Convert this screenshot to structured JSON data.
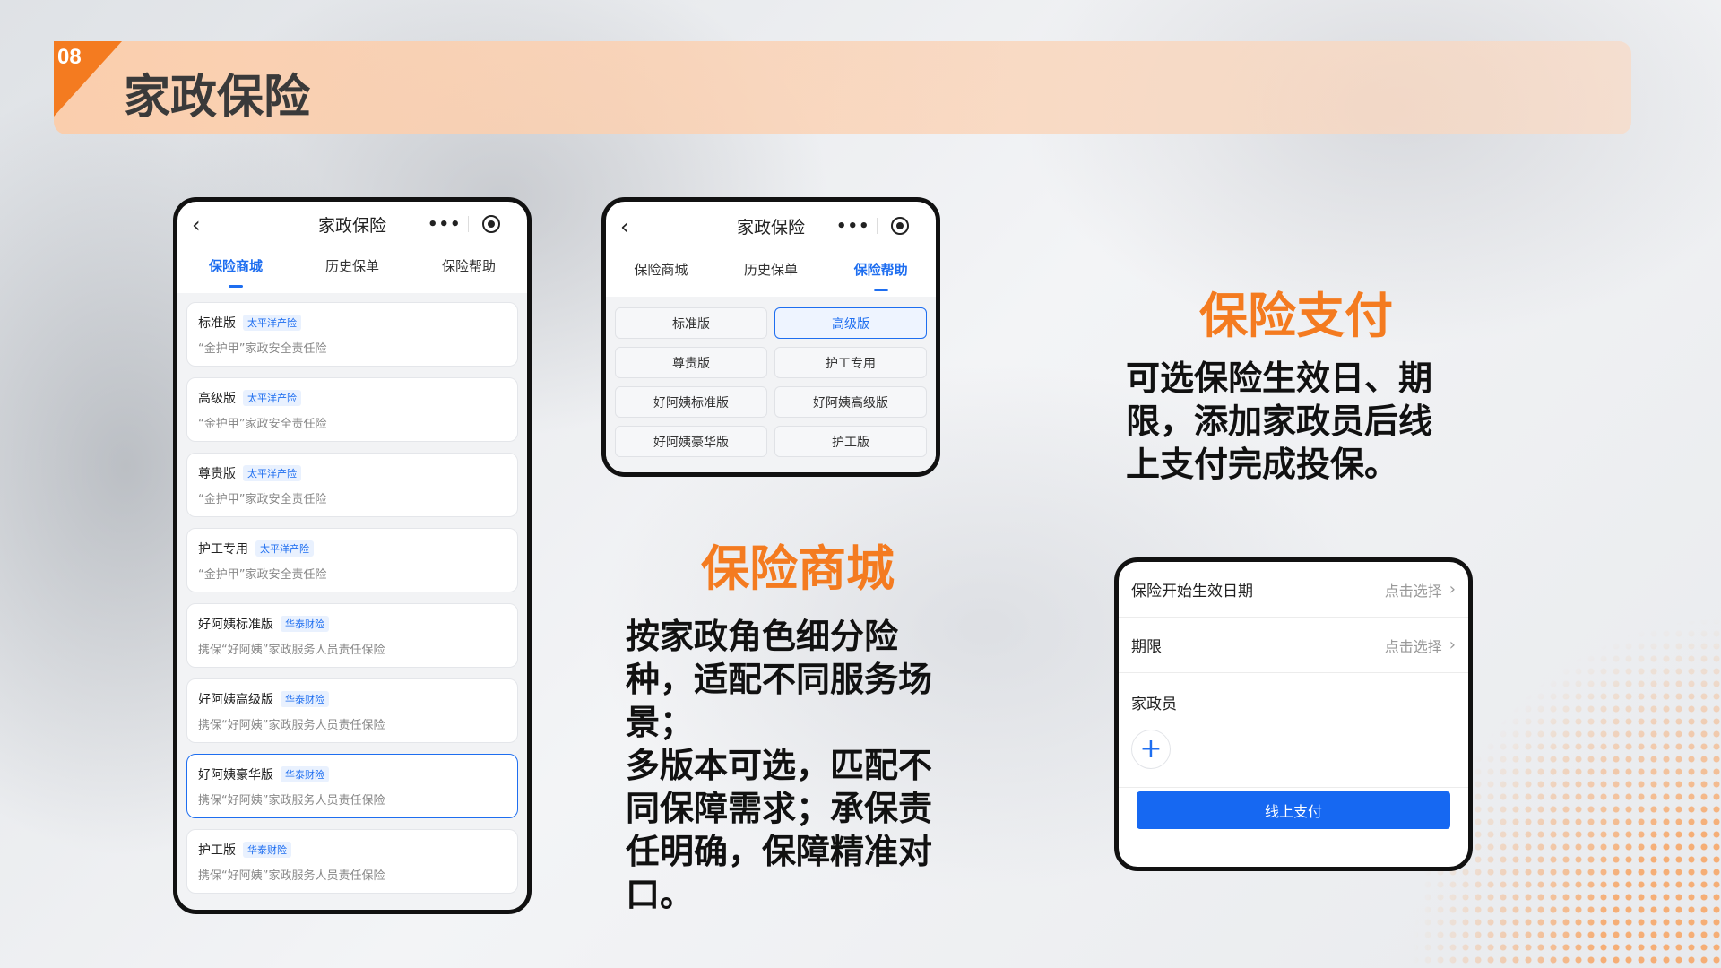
{
  "header": {
    "number": "08",
    "title": "家政保险"
  },
  "colors": {
    "accent": "#f47b20",
    "primary_blue": "#1e6ef0",
    "pay_button": "#1668f2"
  },
  "phone_common": {
    "title": "家政保险",
    "back_icon": "‹",
    "menu_icon": "•••",
    "tabs": [
      "保险商城",
      "历史保单",
      "保险帮助"
    ]
  },
  "phone1": {
    "active_tab": 0,
    "products": [
      {
        "name": "标准版",
        "tag": "太平洋产险",
        "desc": "“金护甲”家政安全责任险",
        "selected": false
      },
      {
        "name": "高级版",
        "tag": "太平洋产险",
        "desc": "“金护甲”家政安全责任险",
        "selected": false
      },
      {
        "name": "尊贵版",
        "tag": "太平洋产险",
        "desc": "“金护甲”家政安全责任险",
        "selected": false
      },
      {
        "name": "护工专用",
        "tag": "太平洋产险",
        "desc": "“金护甲”家政安全责任险",
        "selected": false
      },
      {
        "name": "好阿姨标准版",
        "tag": "华泰财险",
        "desc": "携保“好阿姨”家政服务人员责任保险",
        "selected": false
      },
      {
        "name": "好阿姨高级版",
        "tag": "华泰财险",
        "desc": "携保“好阿姨”家政服务人员责任保险",
        "selected": false
      },
      {
        "name": "好阿姨豪华版",
        "tag": "华泰财险",
        "desc": "携保“好阿姨”家政服务人员责任保险",
        "selected": true
      },
      {
        "name": "护工版",
        "tag": "华泰财险",
        "desc": "携保“好阿姨”家政服务人员责任保险",
        "selected": false
      }
    ]
  },
  "phone2": {
    "active_tab": 2,
    "versions": [
      "标准版",
      "高级版",
      "尊贵版",
      "护工专用",
      "好阿姨标准版",
      "好阿姨高级版",
      "好阿姨豪华版",
      "护工版"
    ],
    "selected_version": 1
  },
  "phone3": {
    "start_date_label": "保险开始生效日期",
    "start_date_value": "点击选择",
    "period_label": "期限",
    "period_value": "点击选择",
    "staff_label": "家政员",
    "add_icon": "+",
    "pay_button": "线上支付"
  },
  "section_mall": {
    "heading": "保险商城",
    "lines": [
      "按家政角色细分险",
      "种，适配不同服务场",
      "景；",
      "多版本可选，匹配不",
      "同保障需求；承保责",
      "任明确，保障精准对",
      "口。"
    ]
  },
  "section_pay": {
    "heading": "保险支付",
    "lines": [
      "可选保险生效日、期",
      "限，添加家政员后线",
      "上支付完成投保。"
    ]
  }
}
